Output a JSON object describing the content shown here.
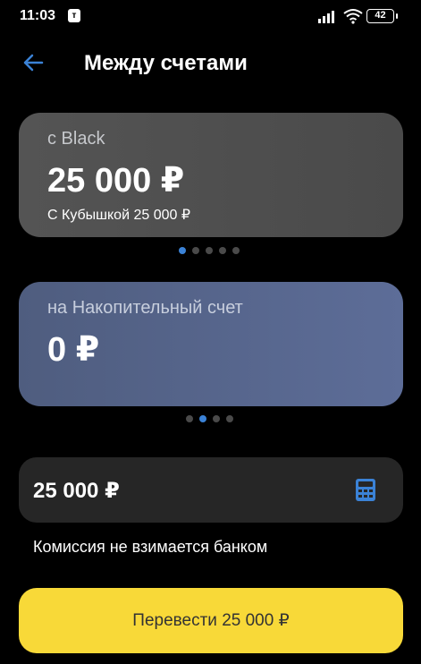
{
  "status_bar": {
    "time": "11:03",
    "app_badge": "т",
    "battery": "42"
  },
  "header": {
    "title": "Между счетами",
    "back_icon": "arrow-left-icon"
  },
  "source_card": {
    "label": "с Black",
    "amount": "25 000 ₽",
    "sub": "С Кубышкой 25 000 ₽"
  },
  "source_pager": {
    "count": 5,
    "active_index": 0
  },
  "dest_card": {
    "label": "на Накопительный счет",
    "amount": "0 ₽"
  },
  "dest_pager": {
    "count": 4,
    "active_index": 1
  },
  "amount_field": {
    "value": "25 000 ₽",
    "icon": "calculator-icon"
  },
  "commission_text": "Комиссия не взимается банком",
  "transfer_button": {
    "label": "Перевести 25 000 ₽"
  },
  "colors": {
    "accent_blue": "#3b82d6",
    "button_yellow": "#f8d938",
    "background": "#000000"
  }
}
